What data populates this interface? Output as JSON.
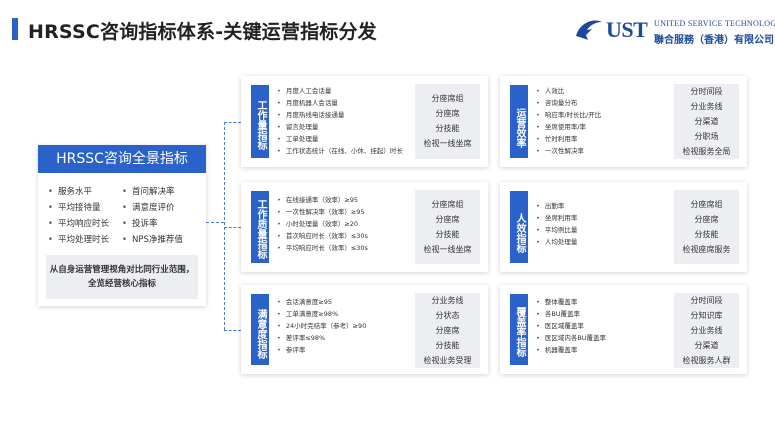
{
  "header": {
    "title": "HRSSC咨询指标体系-关键运营指标分发"
  },
  "logo": {
    "mark": "UST",
    "english_name": "UNITED SERVICE TECHNOLOGY",
    "chinese_name": "聯合服務（香港）有限公司",
    "brand_color": "#1a4a9c"
  },
  "overview": {
    "heading": "HRSSC咨询全景指标",
    "items": [
      "服务水平",
      "首问解决率",
      "平均接待量",
      "满意度评价",
      "平均响应时长",
      "投诉率",
      "平均处理时长",
      "NPS净推荐值"
    ],
    "summary": [
      "从自身运营管理视角对比同行业范围，",
      "全览经营核心指标"
    ]
  },
  "colors": {
    "accent": "#2a62c9",
    "panel_bg": "#eceef2"
  },
  "left_cards": [
    {
      "tab": "工作量指标",
      "items": [
        "月度人工会话量",
        "月度机器人会话量",
        "月度热线电话接通量",
        "留言处理量",
        "工单处理量",
        "工作状态统计（在线、小休、挂起）时长"
      ],
      "groups": [
        "分座席组",
        "分座席",
        "分技能",
        "检视一线坐席"
      ]
    },
    {
      "tab": "工作质量指标",
      "items": [
        "在线接通率（效率）≥95",
        "一次性解决率（效率）≥95",
        "小时处理量（效率）≥20",
        "首次响应时长（效率）≤30s",
        "平均响应时长（效率）≤30s"
      ],
      "groups": [
        "分座席组",
        "分座席",
        "分技能",
        "检视一线坐席"
      ]
    },
    {
      "tab": "满意度指标",
      "items": [
        "会话满意度≥95",
        "工单满意度≥98%",
        "24小时完结率（参考）≥90",
        "差评率≤98%",
        "参评率"
      ],
      "groups": [
        "分业务线",
        "分状态",
        "分座席",
        "分技能",
        "检视业务受理"
      ]
    }
  ],
  "right_cards": [
    {
      "tab": "运营效率",
      "items": [
        "人效比",
        "咨询量分布",
        "响应率/时长比/开比",
        "坐席使用率/率",
        "忙时利用率",
        "一次性解决率"
      ],
      "groups": [
        "分时间段",
        "分业务线",
        "分渠道",
        "分职场",
        "检视服务全局"
      ]
    },
    {
      "tab": "人效指标",
      "items": [
        "出勤率",
        "坐席利用率",
        "平均例比量",
        "人均处理量"
      ],
      "groups": [
        "分座席组",
        "分座席",
        "分技能",
        "检视座席服务"
      ]
    },
    {
      "tab": "覆盖率指标",
      "items": [
        "整体覆盖率",
        "各BU覆盖率",
        "医区域覆盖率",
        "医区域内各BU覆盖率",
        "机器覆盖率"
      ],
      "groups": [
        "分时间段",
        "分知识库",
        "分业务线",
        "分渠道",
        "检视服务人群"
      ]
    }
  ]
}
